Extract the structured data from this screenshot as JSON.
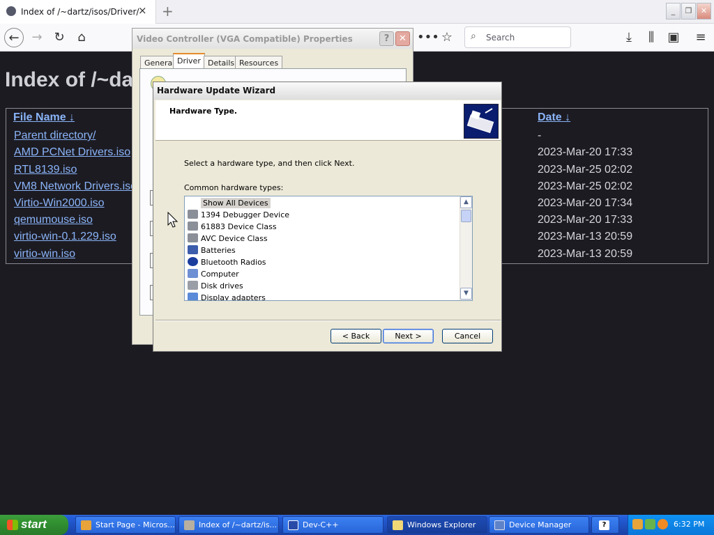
{
  "browser": {
    "tab_title": "Index of /~dartz/isos/Driver/",
    "tab_close": "×",
    "new_tab": "+",
    "search_placeholder": "Search",
    "window_controls": {
      "minimize": "_",
      "maximize": "❐",
      "close": "✕"
    }
  },
  "page": {
    "title": "Index of /~da",
    "columns": {
      "file_name": "File Name ↓",
      "date": "Date ↓"
    },
    "rows": [
      {
        "name": "Parent directory/",
        "date": "-"
      },
      {
        "name": "AMD PCNet Drivers.iso",
        "date": "2023-Mar-20 17:33"
      },
      {
        "name": "RTL8139.iso",
        "date": "2023-Mar-25 02:02"
      },
      {
        "name": "VM8 Network Drivers.iso",
        "date": "2023-Mar-25 02:02"
      },
      {
        "name": "Virtio-Win2000.iso",
        "date": "2023-Mar-20 17:34"
      },
      {
        "name": "qemumouse.iso",
        "date": "2023-Mar-20 17:33"
      },
      {
        "name": "virtio-win-0.1.229.iso",
        "date": "2023-Mar-13 20:59"
      },
      {
        "name": "virtio-win.iso",
        "date": "2023-Mar-13 20:59"
      }
    ]
  },
  "properties_dialog": {
    "title": "Video Controller (VGA Compatible) Properties",
    "help": "?",
    "close": "✕",
    "tabs": [
      "General",
      "Driver",
      "Details",
      "Resources"
    ],
    "active_tab": "Driver"
  },
  "wizard": {
    "title": "Hardware Update Wizard",
    "heading": "Hardware Type.",
    "instruction": "Select a hardware type, and then click Next.",
    "list_label": "Common hardware types:",
    "items": [
      {
        "label": "Show All Devices",
        "selected": true
      },
      {
        "label": "1394 Debugger Device"
      },
      {
        "label": "61883 Device Class"
      },
      {
        "label": "AVC Device Class"
      },
      {
        "label": "Batteries"
      },
      {
        "label": "Bluetooth Radios"
      },
      {
        "label": "Computer"
      },
      {
        "label": "Disk drives"
      },
      {
        "label": "Display adapters"
      }
    ],
    "buttons": {
      "back": "< Back",
      "next": "Next >",
      "cancel": "Cancel"
    }
  },
  "taskbar": {
    "start": "start",
    "tasks": [
      {
        "label": "Start Page - Micros..."
      },
      {
        "label": "Index of /~dartz/is..."
      },
      {
        "label": "Dev-C++"
      },
      {
        "label": "Windows Explorer",
        "active": true
      },
      {
        "label": "Device Manager"
      }
    ],
    "clock": "6:32 PM"
  },
  "colors": {
    "page_bg": "#1c1b22",
    "link": "#8ab4f8",
    "xp_taskbar": "#245edb",
    "xp_start": "#3c9e3c"
  }
}
